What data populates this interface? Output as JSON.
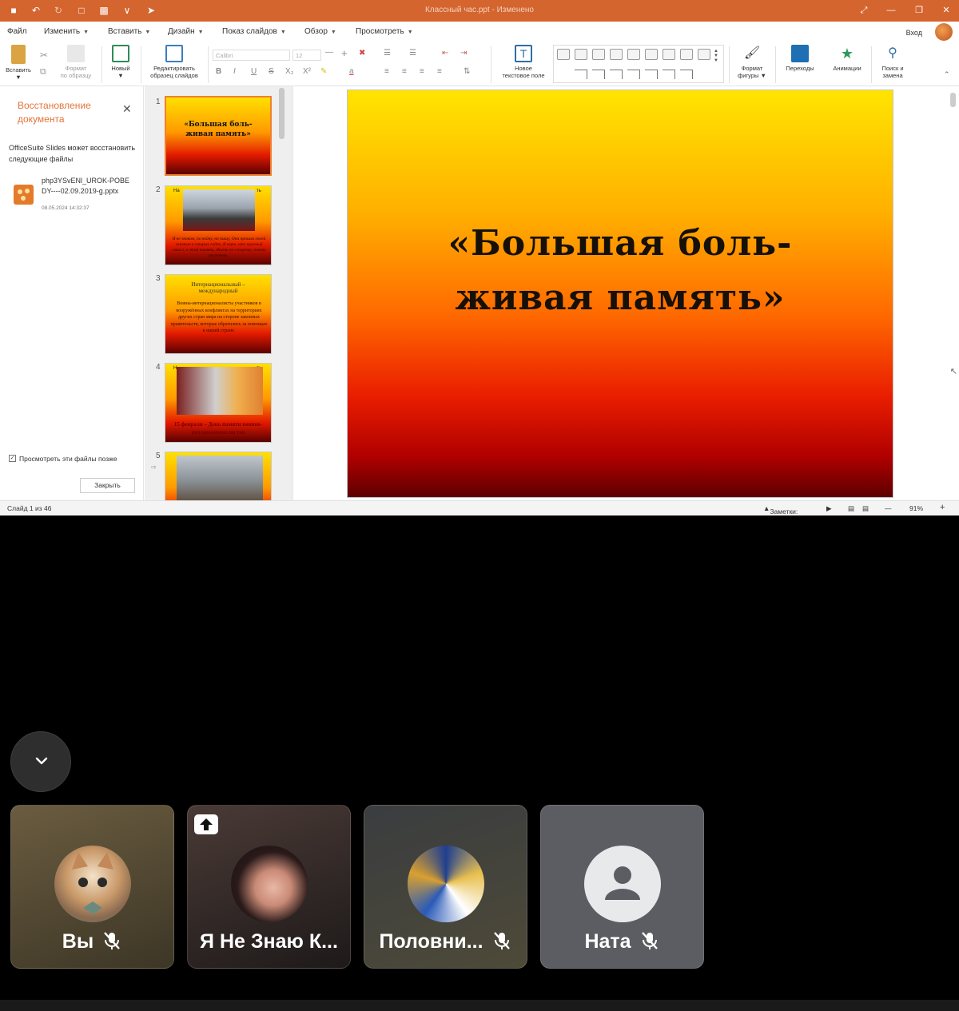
{
  "app": {
    "window_title": "Классный час.ppt - Изменено",
    "login_label": "Вход"
  },
  "menu": [
    {
      "label": "Файл",
      "has_caret": false
    },
    {
      "label": "Изменить",
      "has_caret": true
    },
    {
      "label": "Вставить",
      "has_caret": true
    },
    {
      "label": "Дизайн",
      "has_caret": true
    },
    {
      "label": "Показ слайдов",
      "has_caret": true
    },
    {
      "label": "Обзор",
      "has_caret": true
    },
    {
      "label": "Просмотреть",
      "has_caret": true
    }
  ],
  "ribbon": {
    "paste": "Вставить",
    "format_painter": [
      "Формат",
      "по образцу"
    ],
    "new_slide": "Новый",
    "edit_master": [
      "Редактировать",
      "образец слайдов"
    ],
    "font_name": "Calibri",
    "font_size": "12",
    "new_textbox": [
      "Новое",
      "текстовое поле"
    ],
    "shape_format": [
      "Формат",
      "фигуры"
    ],
    "transitions": "Переходы",
    "animations": "Анимации",
    "find_replace": [
      "Поиск и",
      "замена"
    ]
  },
  "recovery": {
    "title": "Восстановление документа",
    "description": "OfficeSuite Slides может восстановить следующие файлы",
    "file_name": "php3YSvENl_UROK-POBEDY----02.09.2019-g.pptx",
    "file_date": "08.05.2024 14:32:37",
    "checkbox_label": "Просмотреть эти файлы позже",
    "checkbox_checked": true,
    "close_button": "Закрыть"
  },
  "slides_panel": {
    "thumbnails": [
      {
        "number": "1",
        "title": "«Большая боль-живая память»"
      },
      {
        "number": "2",
        "header": "На",
        "header_right": "ть",
        "caption": "Я не знаком, по войну, но пишу, Она прошла своей жизнью в старых годах, Я верю, что красный смысл, в этой память, Жизнь по-старому, помню сражения..."
      },
      {
        "number": "3",
        "header": "Интернациональный – международный",
        "body": "Воины-интернационалисты участников в вооружённых конфликтах на территориях других стран мира на стороне законных правительств, которые обратились за помощью к нашей стране."
      },
      {
        "number": "4",
        "header": "Н",
        "header_right": "ть",
        "caption": "15 февраля – День памяти воинов-интернационалистов"
      },
      {
        "number": "5"
      }
    ]
  },
  "main_slide": {
    "title_line1": "«Большая боль-",
    "title_line2": "живая память»"
  },
  "status": {
    "slide_counter": "Слайд 1 из 46",
    "notes": "Заметки: 0",
    "zoom": "91%"
  },
  "meeting": {
    "participants": [
      {
        "name": "Вы",
        "muted": true,
        "avatar": "cat-cartoon-avatar",
        "tile_color": "#4f4530"
      },
      {
        "name": "Я Не Знаю К...",
        "muted": false,
        "avatar": "woman-photo-avatar",
        "tile_color": "#3a2e2c",
        "badge": "share-screen-icon"
      },
      {
        "name": "Половни...",
        "muted": true,
        "avatar": "anime-character-avatar",
        "tile_color": "#3c3c34"
      },
      {
        "name": "Ната",
        "muted": true,
        "avatar": "default-person-avatar",
        "tile_color": "#5b5d62"
      }
    ]
  },
  "colors": {
    "titlebar": "#d4652f",
    "accent": "#e4733a",
    "slide_gradient": [
      "#ffe400",
      "#ff6a00",
      "#ea1e00",
      "#5e0000"
    ]
  }
}
